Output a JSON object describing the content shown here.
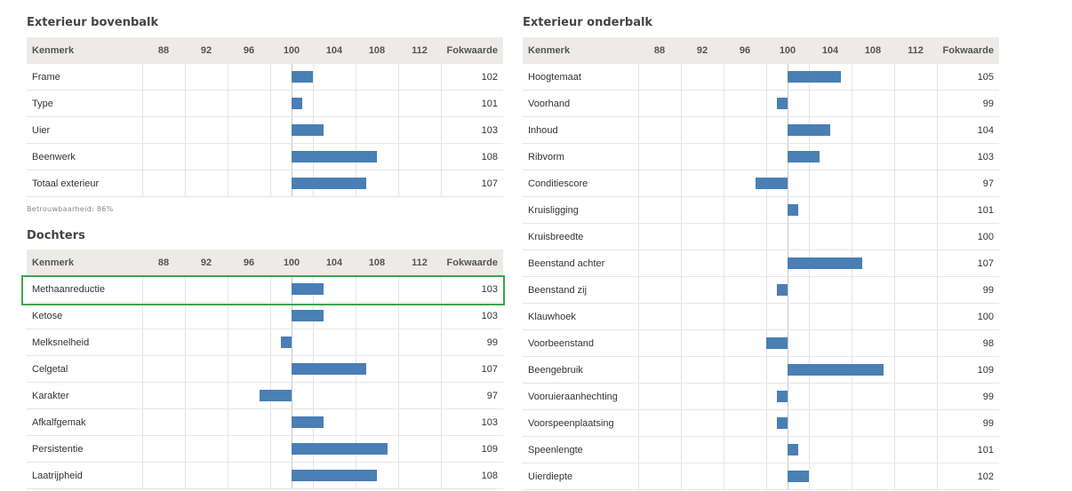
{
  "header": {
    "col_kenmerk": "Kenmerk",
    "col_fokwaarde": "Fokwaarde",
    "ticks": [
      "88",
      "92",
      "96",
      "100",
      "104",
      "108",
      "112"
    ]
  },
  "chart_data": [
    {
      "type": "bar",
      "title": "Exterieur bovenbalk",
      "xlim": [
        86,
        114
      ],
      "baseline": 100,
      "categories": [
        "Frame",
        "Type",
        "Uier",
        "Beenwerk",
        "Totaal exterieur"
      ],
      "values": [
        102,
        101,
        103,
        108,
        107
      ],
      "note": "Betrouwbaarheid: 86%"
    },
    {
      "type": "bar",
      "title": "Dochters",
      "xlim": [
        86,
        114
      ],
      "baseline": 100,
      "categories": [
        "Methaanreductie",
        "Ketose",
        "Melksnelheid",
        "Celgetal",
        "Karakter",
        "Afkalfgemak",
        "Persistentie",
        "Laatrijpheid"
      ],
      "values": [
        103,
        103,
        99,
        107,
        97,
        103,
        109,
        108
      ],
      "highlighted": "Methaanreductie"
    },
    {
      "type": "bar",
      "title": "Exterieur onderbalk",
      "xlim": [
        86,
        114
      ],
      "baseline": 100,
      "categories": [
        "Hoogtemaat",
        "Voorhand",
        "Inhoud",
        "Ribvorm",
        "Conditiescore",
        "Kruisligging",
        "Kruisbreedte",
        "Beenstand achter",
        "Beenstand zij",
        "Klauwhoek",
        "Voorbeenstand",
        "Beengebruik",
        "Vooruieraanhechting",
        "Voorspeenplaatsing",
        "Speenlengte",
        "Uierdiepte"
      ],
      "values": [
        105,
        99,
        104,
        103,
        97,
        101,
        100,
        107,
        99,
        100,
        98,
        109,
        99,
        99,
        101,
        102
      ]
    }
  ],
  "colors": {
    "bar": "#4a7fb5",
    "highlight": "#3aa64f",
    "header_bg": "#ecebe7"
  }
}
